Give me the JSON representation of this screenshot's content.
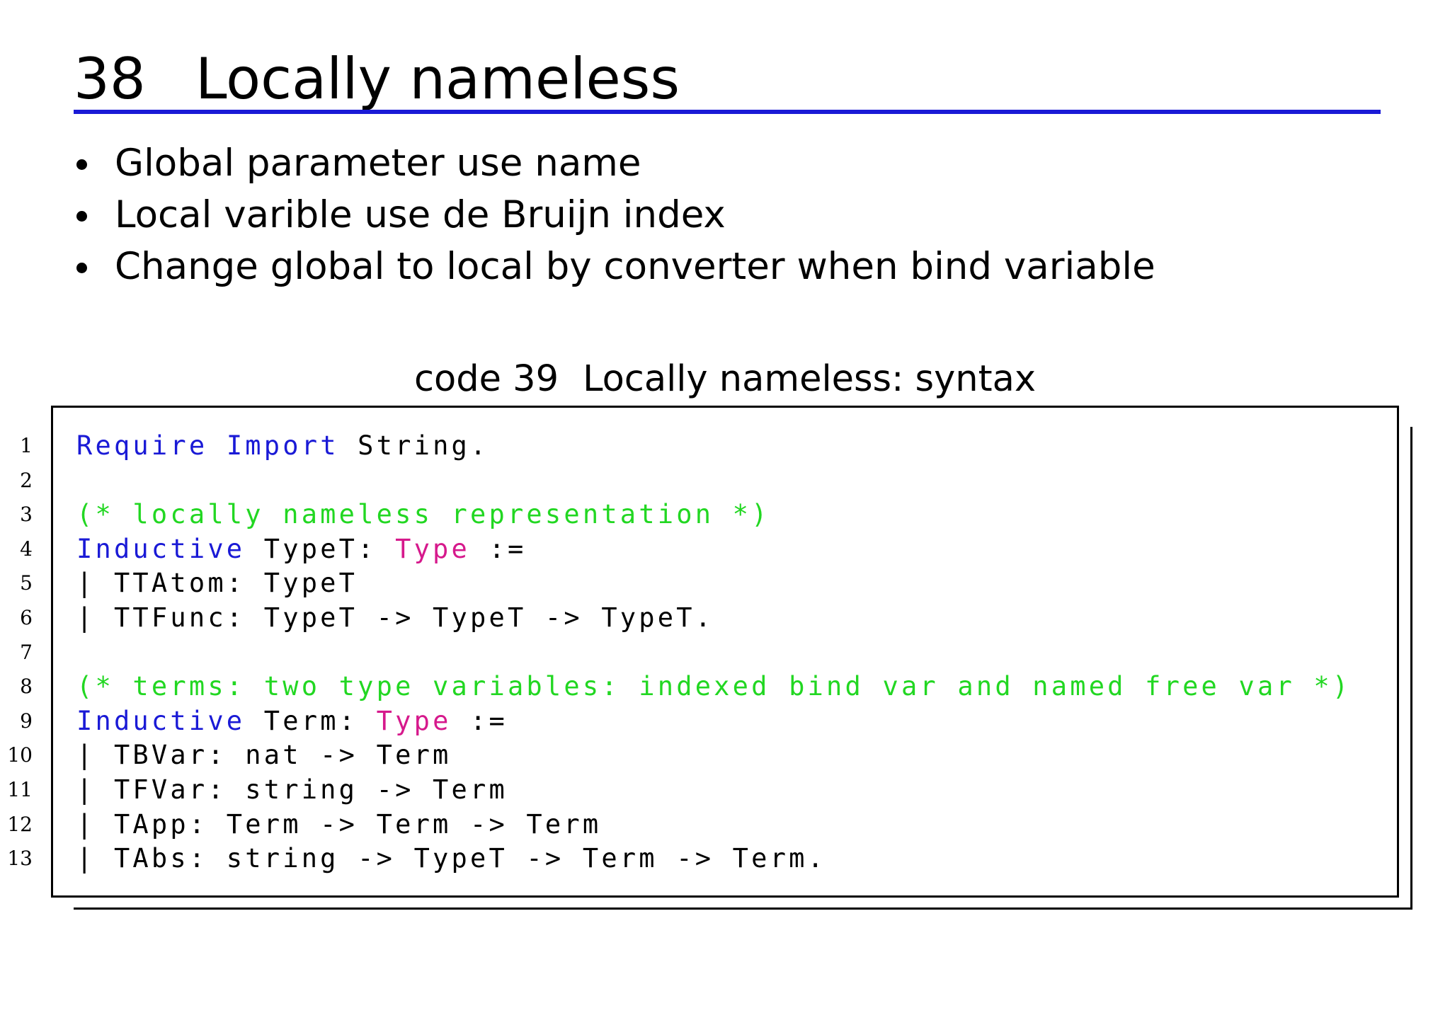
{
  "section": {
    "number": "38",
    "title": "Locally nameless"
  },
  "bullets": [
    "Global parameter use name",
    "Local varible use de Bruijn index",
    "Change global to local by converter when bind variable"
  ],
  "caption": {
    "label": "code 39",
    "text": "Locally nameless: syntax"
  },
  "colors": {
    "title_rule": "#1a1ad6",
    "keyword": "#1a1ad6",
    "comment": "#22d722",
    "type_keyword": "#d6198c",
    "text": "#000000"
  },
  "code": {
    "line_numbers": [
      "1",
      "2",
      "3",
      "4",
      "5",
      "6",
      "7",
      "8",
      "9",
      "10",
      "11",
      "12",
      "13"
    ],
    "lines": [
      [
        {
          "t": "Require",
          "c": "kw"
        },
        {
          "t": " "
        },
        {
          "t": "Import",
          "c": "kw"
        },
        {
          "t": " String."
        }
      ],
      [],
      [
        {
          "t": "(* locally nameless representation *)",
          "c": "cm"
        }
      ],
      [
        {
          "t": "Inductive",
          "c": "kw"
        },
        {
          "t": " TypeT: "
        },
        {
          "t": "Type",
          "c": "ty"
        },
        {
          "t": " :="
        }
      ],
      [
        {
          "t": "| TTAtom: TypeT"
        }
      ],
      [
        {
          "t": "| TTFunc: TypeT -> TypeT -> TypeT."
        }
      ],
      [],
      [
        {
          "t": "(* terms: two type variables: indexed bind var and named free var *)",
          "c": "cm"
        }
      ],
      [
        {
          "t": "Inductive",
          "c": "kw"
        },
        {
          "t": " Term: "
        },
        {
          "t": "Type",
          "c": "ty"
        },
        {
          "t": " :="
        }
      ],
      [
        {
          "t": "| TBVar: nat -> Term"
        }
      ],
      [
        {
          "t": "| TFVar: string -> Term"
        }
      ],
      [
        {
          "t": "| TApp: Term -> Term -> Term"
        }
      ],
      [
        {
          "t": "| TAbs: string -> TypeT -> Term -> Term."
        }
      ]
    ]
  }
}
